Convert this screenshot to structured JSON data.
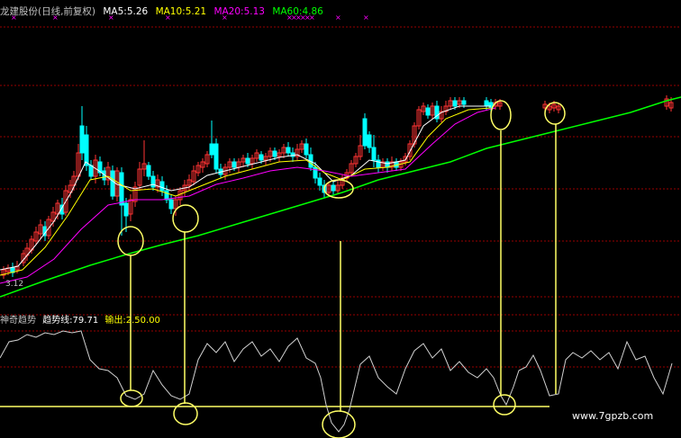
{
  "header": {
    "stock_label": "龙建股份(日线,前复权)",
    "ma5": "MA5:5.26",
    "ma10": "MA10:5.21",
    "ma20": "MA20:5.13",
    "ma60": "MA60:4.86"
  },
  "indicator_header": {
    "name": "神奇趋势",
    "trend_label": "趋势线:79.71",
    "output_label": "输出:2.50.00"
  },
  "price_label": "3.12",
  "watermark": "www.7gpzb.com",
  "colors": {
    "ma5": "#ffffff",
    "ma10": "#ffff00",
    "ma20": "#ff00ff",
    "ma60": "#00ff00",
    "up": "#ff3333",
    "down": "#00ffff",
    "annotation": "#ffff66",
    "grid": "#990000"
  },
  "chart_data": [
    {
      "type": "candlestick",
      "title": "",
      "series": [
        {
          "name": "MA5:5.26"
        },
        {
          "name": "MA10:5.21"
        },
        {
          "name": "MA20:5.13"
        },
        {
          "name": "MA60:4.86"
        }
      ],
      "grid": true
    },
    {
      "type": "line",
      "title": "",
      "series": [
        {
          "name": "趋势线:79.71"
        }
      ],
      "grid": true
    }
  ]
}
